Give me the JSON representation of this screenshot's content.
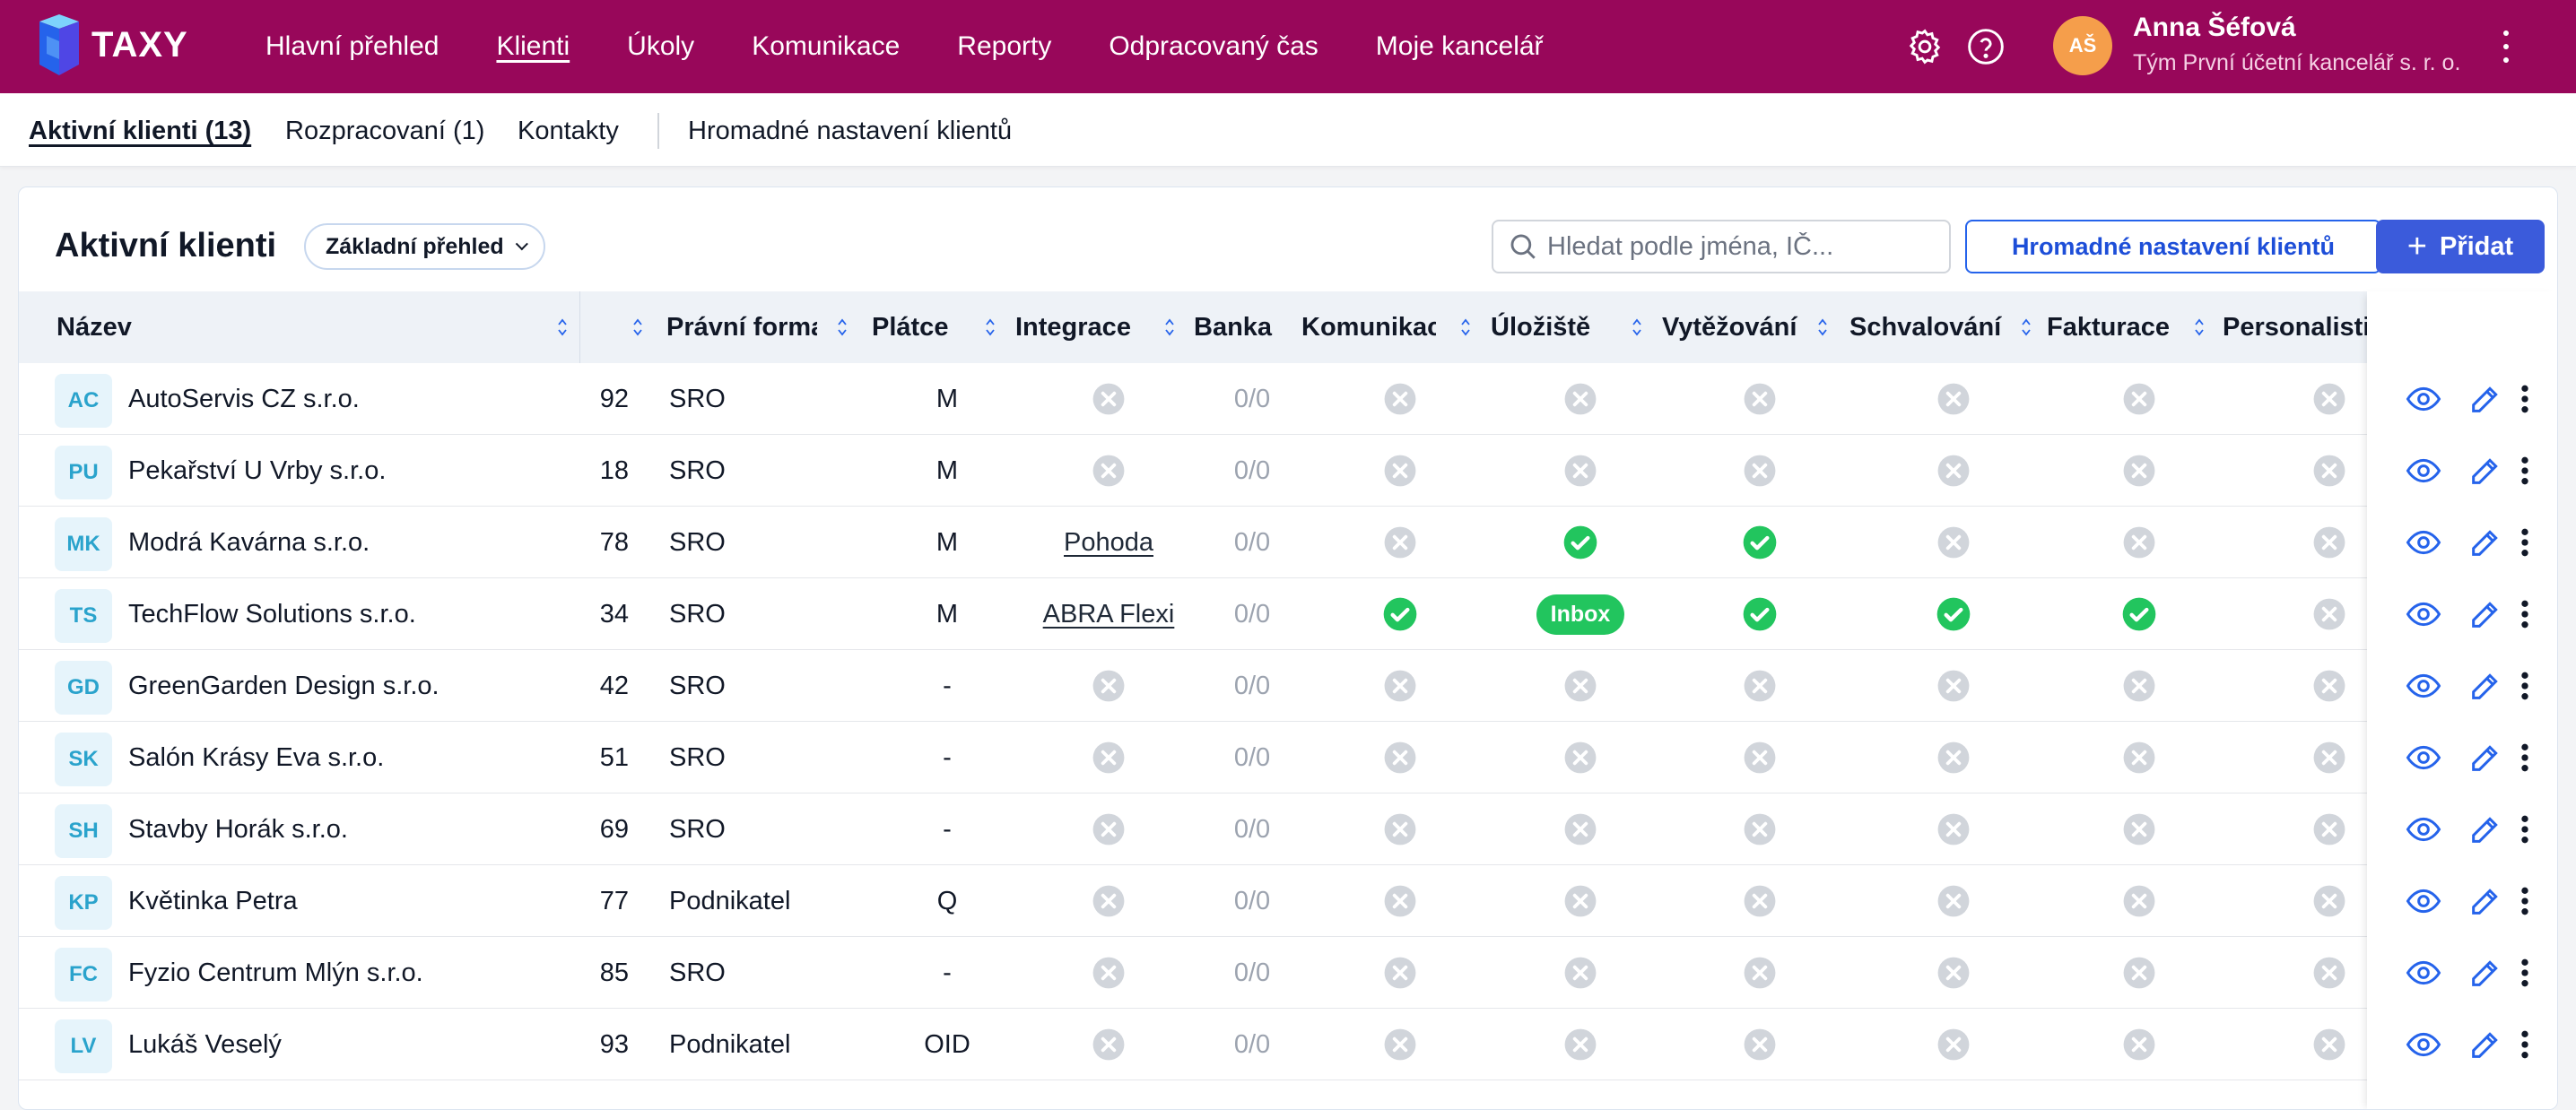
{
  "app": {
    "name": "TAXY"
  },
  "nav": {
    "items": [
      "Hlavní přehled",
      "Klienti",
      "Úkoly",
      "Komunikace",
      "Reporty",
      "Odpracovaný čas",
      "Moje kancelář"
    ],
    "active": "Klienti"
  },
  "user": {
    "initials": "AŠ",
    "name": "Anna Šéfová",
    "team": "Tým První účetní kancelář s. r. o."
  },
  "subnav": {
    "items": [
      "Aktivní klienti (13)",
      "Rozpracovaní (1)",
      "Kontakty",
      "Hromadné nastavení klientů"
    ],
    "active": "Aktivní klienti (13)"
  },
  "page": {
    "title": "Aktivní klienti",
    "view_select": "Základní přehled",
    "search_placeholder": "Hledat podle jména, IČ...",
    "bulk_button": "Hromadné nastavení klientů",
    "add_button": "Přidat"
  },
  "columns": [
    "Název",
    "",
    "Právní forma",
    "Plátce",
    "Integrace",
    "Banka",
    "Komunikace",
    "Úložiště",
    "Vytěžování",
    "Schvalování",
    "Fakturace",
    "Personalisti"
  ],
  "rows": [
    {
      "initials": "AC",
      "name": "AutoServis CZ s.r.o.",
      "num": "92",
      "form": "SRO",
      "payer": "M",
      "integration": "",
      "bank": "0/0",
      "komunikace": "off",
      "uloziste": "off",
      "vytezovani": "off",
      "schvalovani": "off",
      "fakturace": "off",
      "personalisti": "off"
    },
    {
      "initials": "PU",
      "name": "Pekařství U Vrby s.r.o.",
      "num": "18",
      "form": "SRO",
      "payer": "M",
      "integration": "",
      "bank": "0/0",
      "komunikace": "off",
      "uloziste": "off",
      "vytezovani": "off",
      "schvalovani": "off",
      "fakturace": "off",
      "personalisti": "off"
    },
    {
      "initials": "MK",
      "name": "Modrá Kavárna s.r.o.",
      "num": "78",
      "form": "SRO",
      "payer": "M",
      "integration": "Pohoda",
      "bank": "0/0",
      "komunikace": "off",
      "uloziste": "on",
      "vytezovani": "on",
      "schvalovani": "off",
      "fakturace": "off",
      "personalisti": "off"
    },
    {
      "initials": "TS",
      "name": "TechFlow Solutions s.r.o.",
      "num": "34",
      "form": "SRO",
      "payer": "M",
      "integration": "ABRA Flexi",
      "bank": "0/0",
      "komunikace": "on",
      "uloziste": "Inbox",
      "vytezovani": "on",
      "schvalovani": "on",
      "fakturace": "on",
      "personalisti": "off"
    },
    {
      "initials": "GD",
      "name": "GreenGarden Design s.r.o.",
      "num": "42",
      "form": "SRO",
      "payer": "-",
      "integration": "",
      "bank": "0/0",
      "komunikace": "off",
      "uloziste": "off",
      "vytezovani": "off",
      "schvalovani": "off",
      "fakturace": "off",
      "personalisti": "off"
    },
    {
      "initials": "SK",
      "name": "Salón Krásy Eva s.r.o.",
      "num": "51",
      "form": "SRO",
      "payer": "-",
      "integration": "",
      "bank": "0/0",
      "komunikace": "off",
      "uloziste": "off",
      "vytezovani": "off",
      "schvalovani": "off",
      "fakturace": "off",
      "personalisti": "off"
    },
    {
      "initials": "SH",
      "name": "Stavby Horák s.r.o.",
      "num": "69",
      "form": "SRO",
      "payer": "-",
      "integration": "",
      "bank": "0/0",
      "komunikace": "off",
      "uloziste": "off",
      "vytezovani": "off",
      "schvalovani": "off",
      "fakturace": "off",
      "personalisti": "off"
    },
    {
      "initials": "KP",
      "name": "Květinka Petra",
      "num": "77",
      "form": "Podnikatel",
      "payer": "Q",
      "integration": "",
      "bank": "0/0",
      "komunikace": "off",
      "uloziste": "off",
      "vytezovani": "off",
      "schvalovani": "off",
      "fakturace": "off",
      "personalisti": "off"
    },
    {
      "initials": "FC",
      "name": "Fyzio Centrum Mlýn s.r.o.",
      "num": "85",
      "form": "SRO",
      "payer": "-",
      "integration": "",
      "bank": "0/0",
      "komunikace": "off",
      "uloziste": "off",
      "vytezovani": "off",
      "schvalovani": "off",
      "fakturace": "off",
      "personalisti": "off"
    },
    {
      "initials": "LV",
      "name": "Lukáš Veselý",
      "num": "93",
      "form": "Podnikatel",
      "payer": "OID",
      "integration": "",
      "bank": "0/0",
      "komunikace": "off",
      "uloziste": "off",
      "vytezovani": "off",
      "schvalovani": "off",
      "fakturace": "off",
      "personalisti": "off"
    },
    {
      "initials": "",
      "name": "",
      "num": "",
      "form": "",
      "payer": "",
      "integration": "",
      "bank": "",
      "komunikace": "",
      "uloziste": "",
      "vytezovani": "",
      "schvalovani": "",
      "fakturace": "",
      "personalisti": ""
    }
  ],
  "colors": {
    "brand": "#98075a",
    "primary": "#3b5bdb",
    "success": "#22c55e",
    "muted_icon": "#d1d5db"
  },
  "icons": {
    "settings": "gear-icon",
    "help": "help-circle-icon",
    "search": "search-icon",
    "view": "eye-icon",
    "edit": "edit-icon",
    "more": "kebab-icon"
  }
}
